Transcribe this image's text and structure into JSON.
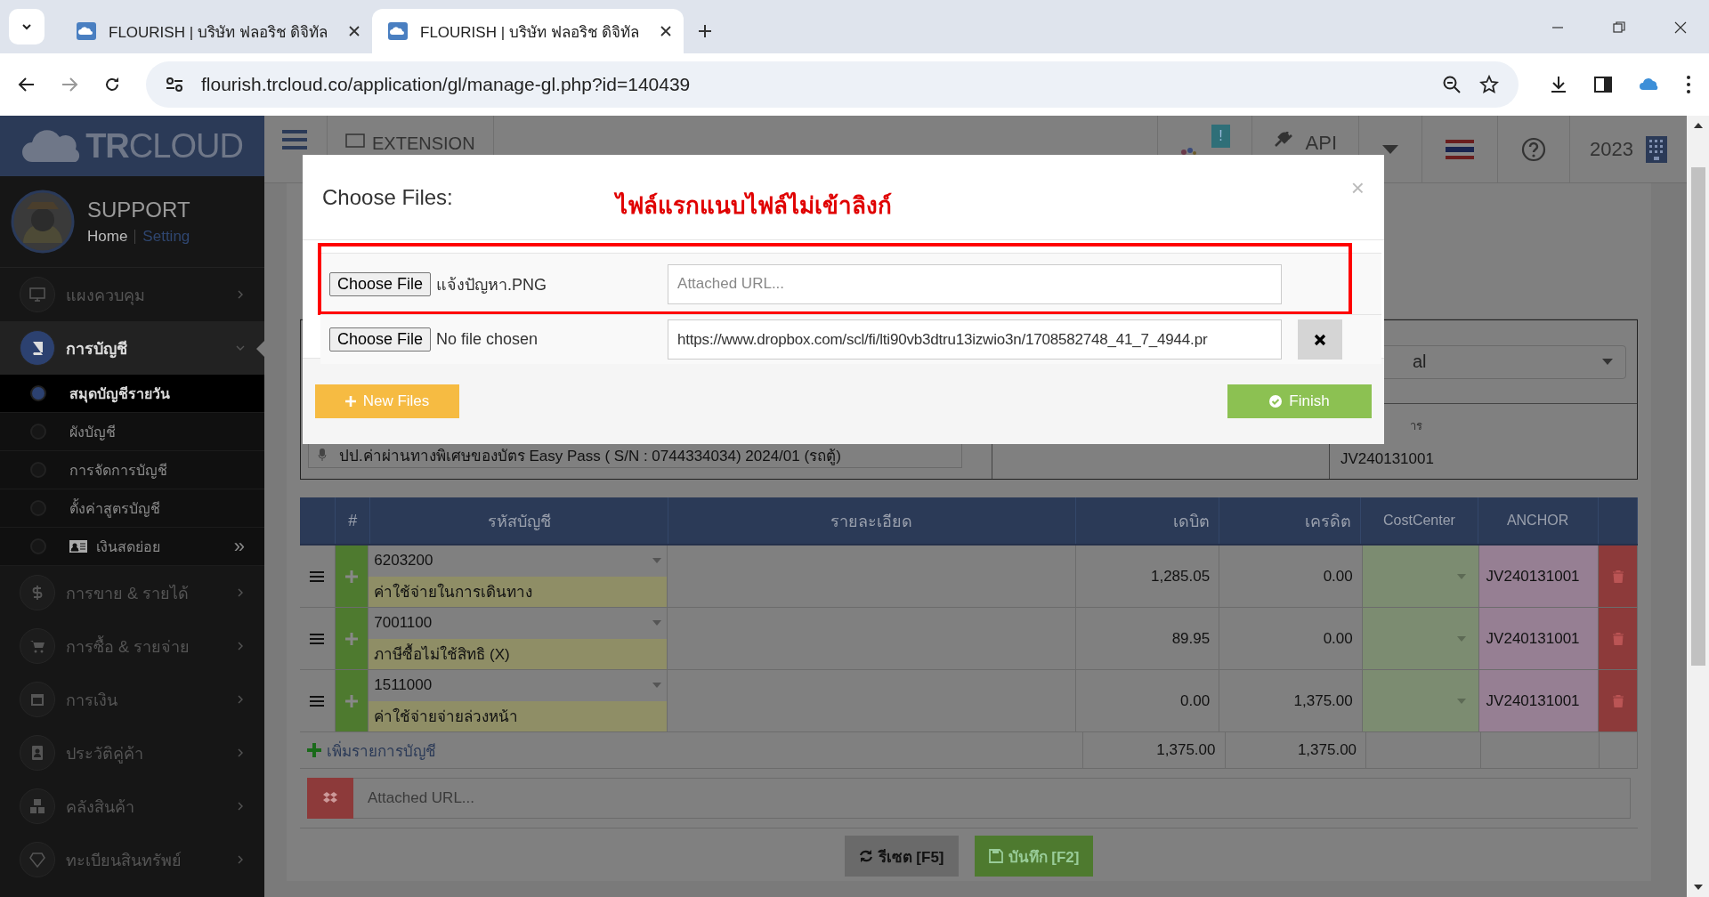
{
  "browser": {
    "tabs": [
      {
        "title": "FLOURISH | บริษัท ฟลอริช ดิจิทัล",
        "selected": false
      },
      {
        "title": "FLOURISH | บริษัท ฟลอริช ดิจิทัล",
        "selected": true
      }
    ],
    "url": "flourish.trcloud.co/application/gl/manage-gl.php?id=140439"
  },
  "header": {
    "logo_bold": "TR",
    "logo_light": "CLOUD",
    "extension": "EXTENSION",
    "badge": "!",
    "api": "API",
    "year": "2023"
  },
  "user": {
    "name": "SUPPORT",
    "links": [
      {
        "label": "Home",
        "selected": true
      },
      {
        "label": "Setting",
        "selected": false
      }
    ]
  },
  "sidebar": {
    "items": [
      {
        "label": "แผงควบคุม",
        "selected": false,
        "expanded": false
      },
      {
        "label": "การบัญชี",
        "selected": true,
        "expanded": true,
        "children": [
          {
            "label": "สมุดบัญชีรายวัน",
            "selected": true,
            "kind": "link"
          },
          {
            "label": "ผังบัญชี",
            "selected": false,
            "kind": "link"
          },
          {
            "label": "การจัดการบัญชี",
            "selected": false,
            "kind": "link"
          },
          {
            "label": "ตั้งค่าสูตรบัญชี",
            "selected": false,
            "kind": "link"
          },
          {
            "label": "เงินสดย่อย",
            "selected": false,
            "kind": "submenu",
            "trailing": "»"
          }
        ]
      },
      {
        "label": "การขาย & รายได้",
        "selected": false,
        "expanded": false
      },
      {
        "label": "การซื้อ & รายจ่าย",
        "selected": false,
        "expanded": false
      },
      {
        "label": "การเงิน",
        "selected": false,
        "expanded": false
      },
      {
        "label": "ประวัติคู่ค้า",
        "selected": false,
        "expanded": false
      },
      {
        "label": "คลังสินค้า",
        "selected": false,
        "expanded": false
      },
      {
        "label": "ทะเบียนสินทรัพย์",
        "selected": false,
        "expanded": false
      }
    ]
  },
  "form": {
    "select_value": "al",
    "doc_label": "าร",
    "doc_number": "JV240131001",
    "memo": "ปป.ค่าผ่านทางพิเศษของบัตร Easy Pass ( S/N : 0744334034)  2024/01 (รถตู้)"
  },
  "table": {
    "columns": [
      "#",
      "รหัสบัญชี",
      "รายละเอียด",
      "เดบิต",
      "เครดิต",
      "CostCenter",
      "ANCHOR"
    ],
    "rows": [
      {
        "code": "6203200",
        "name": "ค่าใช้จ่ายในการเดินทาง",
        "debit": "1,285.05",
        "credit": "0.00",
        "anchor": "JV240131001"
      },
      {
        "code": "7001100",
        "name": "ภาษีซื้อไม่ใช้สิทธิ (X)",
        "debit": "89.95",
        "credit": "0.00",
        "anchor": "JV240131001"
      },
      {
        "code": "1511000",
        "name": "ค่าใช้จ่ายจ่ายล่วงหน้า",
        "debit": "0.00",
        "credit": "1,375.00",
        "anchor": "JV240131001"
      }
    ],
    "add_row": "เพิ่มรายการบัญชี",
    "total_debit": "1,375.00",
    "total_credit": "1,375.00",
    "attach_placeholder": "Attached URL...",
    "buttons": {
      "reset": "รีเซต [F5]",
      "save": "บันทึก [F2]"
    }
  },
  "modal": {
    "title": "Choose Files:",
    "note": "ไฟล์แรกแนบไฟล์ไม่เข้าลิงก์",
    "close": "×",
    "files": [
      {
        "button": "Choose File",
        "file": "แจ้งปัญหา.PNG",
        "placeholder": "Attached URL...",
        "highlighted": true,
        "removable": false
      },
      {
        "button": "Choose File",
        "file": "No file chosen",
        "url": "https://www.dropbox.com/scl/fi/lti90vb3dtru13izwio3n/1708582748_41_7_4944.pr",
        "highlighted": false,
        "removable": true
      }
    ],
    "new_files": "New Files",
    "finish": "Finish"
  }
}
